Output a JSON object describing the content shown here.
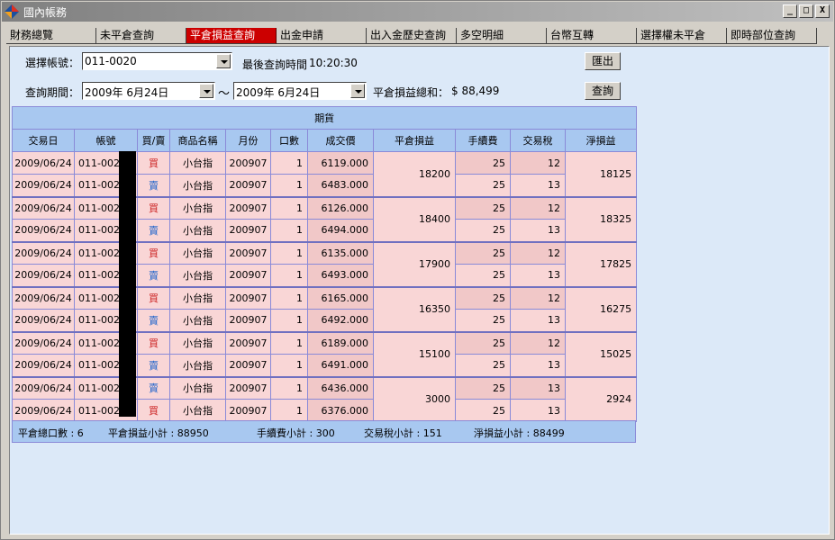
{
  "window": {
    "title": "國內帳務",
    "min": "_",
    "max": "□",
    "close": "X"
  },
  "tabs": [
    "財務總覽",
    "未平倉查詢",
    "平倉損益查詢",
    "出金申請",
    "出入金歷史查詢",
    "多空明細",
    "台幣互轉",
    "選擇權未平倉",
    "即時部位查詢"
  ],
  "active_tab": 2,
  "form": {
    "account_label": "選擇帳號：",
    "account_value": "011-0020",
    "last_query_label": "最後查詢時間",
    "last_query_time": "10:20:30",
    "export_button": "匯出",
    "period_label": "查詢期間：",
    "date_from": "2009年  6月24日",
    "date_sep": "～",
    "date_to": "2009年  6月24日",
    "total_pl_label": "平倉損益總和：",
    "total_pl_value": "$ 88,499",
    "query_button": "查詢"
  },
  "table": {
    "section_title": "期貨",
    "headers": [
      "交易日",
      "帳號",
      "買/賣",
      "商品名稱",
      "月份",
      "口數",
      "成交價",
      "平倉損益",
      "手續費",
      "交易稅",
      "淨損益"
    ],
    "groups": [
      {
        "rows": [
          {
            "date": "2009/06/24",
            "account": "011-0020",
            "side": "買",
            "product": "小台指",
            "month": "200907",
            "qty": "1",
            "price": "6119.000",
            "fee": "25",
            "tax": "12"
          },
          {
            "date": "2009/06/24",
            "account": "011-0020",
            "side": "賣",
            "product": "小台指",
            "month": "200907",
            "qty": "1",
            "price": "6483.000",
            "fee": "25",
            "tax": "13"
          }
        ],
        "pl": "18200",
        "net": "18125"
      },
      {
        "rows": [
          {
            "date": "2009/06/24",
            "account": "011-0020",
            "side": "買",
            "product": "小台指",
            "month": "200907",
            "qty": "1",
            "price": "6126.000",
            "fee": "25",
            "tax": "12"
          },
          {
            "date": "2009/06/24",
            "account": "011-0020",
            "side": "賣",
            "product": "小台指",
            "month": "200907",
            "qty": "1",
            "price": "6494.000",
            "fee": "25",
            "tax": "13"
          }
        ],
        "pl": "18400",
        "net": "18325"
      },
      {
        "rows": [
          {
            "date": "2009/06/24",
            "account": "011-0020",
            "side": "買",
            "product": "小台指",
            "month": "200907",
            "qty": "1",
            "price": "6135.000",
            "fee": "25",
            "tax": "12"
          },
          {
            "date": "2009/06/24",
            "account": "011-0020",
            "side": "賣",
            "product": "小台指",
            "month": "200907",
            "qty": "1",
            "price": "6493.000",
            "fee": "25",
            "tax": "13"
          }
        ],
        "pl": "17900",
        "net": "17825"
      },
      {
        "rows": [
          {
            "date": "2009/06/24",
            "account": "011-0020",
            "side": "買",
            "product": "小台指",
            "month": "200907",
            "qty": "1",
            "price": "6165.000",
            "fee": "25",
            "tax": "12"
          },
          {
            "date": "2009/06/24",
            "account": "011-0020",
            "side": "賣",
            "product": "小台指",
            "month": "200907",
            "qty": "1",
            "price": "6492.000",
            "fee": "25",
            "tax": "13"
          }
        ],
        "pl": "16350",
        "net": "16275"
      },
      {
        "rows": [
          {
            "date": "2009/06/24",
            "account": "011-0020",
            "side": "買",
            "product": "小台指",
            "month": "200907",
            "qty": "1",
            "price": "6189.000",
            "fee": "25",
            "tax": "12"
          },
          {
            "date": "2009/06/24",
            "account": "011-0020",
            "side": "賣",
            "product": "小台指",
            "month": "200907",
            "qty": "1",
            "price": "6491.000",
            "fee": "25",
            "tax": "13"
          }
        ],
        "pl": "15100",
        "net": "15025"
      },
      {
        "rows": [
          {
            "date": "2009/06/24",
            "account": "011-0020",
            "side": "賣",
            "product": "小台指",
            "month": "200907",
            "qty": "1",
            "price": "6436.000",
            "fee": "25",
            "tax": "13"
          },
          {
            "date": "2009/06/24",
            "account": "011-0020",
            "side": "買",
            "product": "小台指",
            "month": "200907",
            "qty": "1",
            "price": "6376.000",
            "fee": "25",
            "tax": "13"
          }
        ],
        "pl": "3000",
        "net": "2924"
      }
    ]
  },
  "footer": {
    "total_qty": "平倉總口數 : 6",
    "pl_subtotal": "平倉損益小計 : 88950",
    "fee_subtotal": "手續費小計 : 300",
    "tax_subtotal": "交易稅小計 : 151",
    "net_subtotal": "淨損益小計 : 88499"
  },
  "colors": {
    "active_tab": "#cc0000",
    "buy": "#cc2222",
    "sell": "#2266cc",
    "row_bg": "#f9d6d6",
    "header_bg": "#a8c8f0",
    "panel_bg": "#dce9f8"
  }
}
